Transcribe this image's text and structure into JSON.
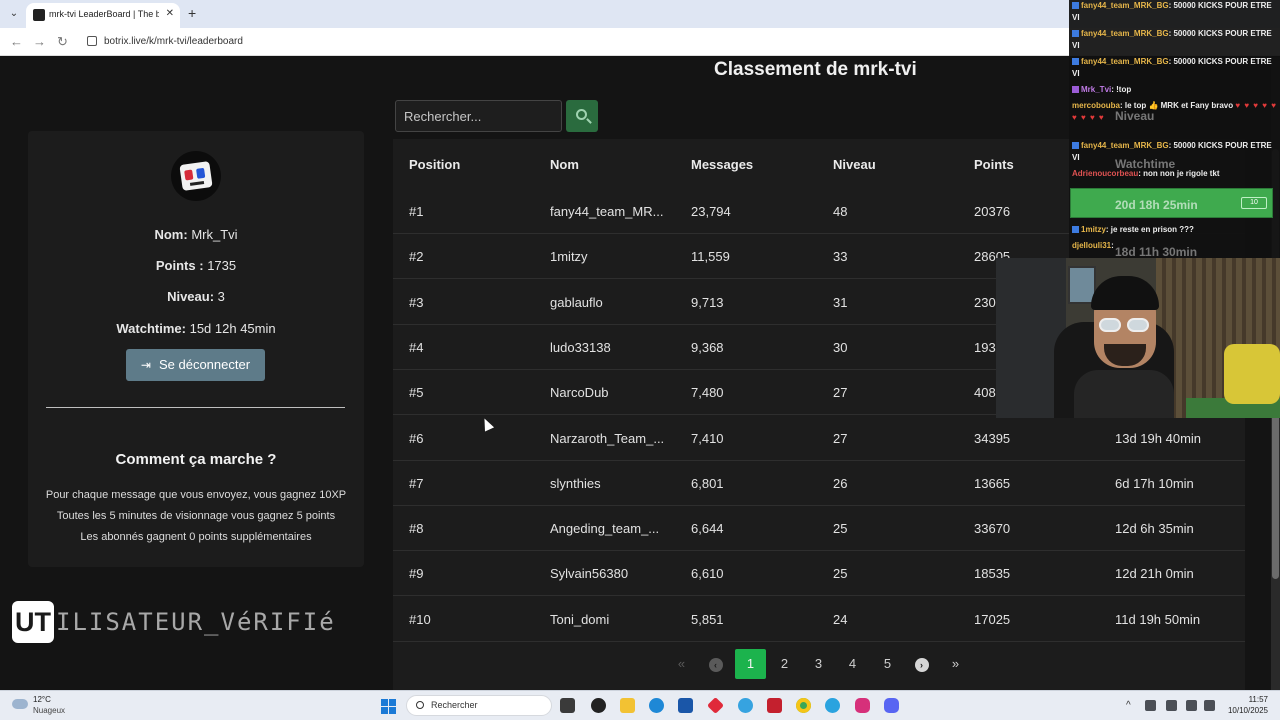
{
  "browser": {
    "tab_title": "mrk-tvi LeaderBoard | The best",
    "url": "botrix.live/k/mrk-tvi/leaderboard"
  },
  "profile": {
    "name_label": "Nom:",
    "name": "Mrk_Tvi",
    "points_label": "Points :",
    "points": "1735",
    "level_label": "Niveau:",
    "level": "3",
    "watchtime_label": "Watchtime:",
    "watchtime": "15d 12h 45min",
    "logout_label": "Se déconnecter"
  },
  "how": {
    "title": "Comment ça marche ?",
    "lines": [
      "Pour chaque message que vous envoyez, vous gagnez 10XP",
      "Toutes les 5 minutes de visionnage vous gagnez 5 points",
      "Les abonnés gagnent 0 points supplémentaires"
    ]
  },
  "overlay": {
    "verified_logo": "UT",
    "verified_text": "ILISATEUR_VéRIFIé"
  },
  "leaderboard": {
    "title": "Classement de mrk-tvi",
    "search_placeholder": "Rechercher...",
    "columns": [
      "Position",
      "Nom",
      "Messages",
      "Niveau",
      "Points"
    ],
    "rows": [
      {
        "position": "#1",
        "name": "fany44_team_MR...",
        "messages": "23,794",
        "level": "48",
        "points": "20376",
        "watchtime": ""
      },
      {
        "position": "#2",
        "name": "1mitzy",
        "messages": "11,559",
        "level": "33",
        "points": "28605",
        "watchtime": ""
      },
      {
        "position": "#3",
        "name": "gablauflo",
        "messages": "9,713",
        "level": "31",
        "points": "230",
        "watchtime": ""
      },
      {
        "position": "#4",
        "name": "ludo33138",
        "messages": "9,368",
        "level": "30",
        "points": "193",
        "watchtime": ""
      },
      {
        "position": "#5",
        "name": "NarcoDub",
        "messages": "7,480",
        "level": "27",
        "points": "408",
        "watchtime": ""
      },
      {
        "position": "#6",
        "name": "Narzaroth_Team_...",
        "messages": "7,410",
        "level": "27",
        "points": "34395",
        "watchtime": "13d 19h 40min"
      },
      {
        "position": "#7",
        "name": "slynthies",
        "messages": "6,801",
        "level": "26",
        "points": "13665",
        "watchtime": "6d 17h 10min"
      },
      {
        "position": "#8",
        "name": "Angeding_team_...",
        "messages": "6,644",
        "level": "25",
        "points": "33670",
        "watchtime": "12d 6h 35min"
      },
      {
        "position": "#9",
        "name": "Sylvain56380",
        "messages": "6,610",
        "level": "25",
        "points": "18535",
        "watchtime": "12d 21h 0min"
      },
      {
        "position": "#10",
        "name": "Toni_domi",
        "messages": "5,851",
        "level": "24",
        "points": "17025",
        "watchtime": "11d 19h 50min"
      }
    ],
    "pages": [
      "1",
      "2",
      "3",
      "4",
      "5"
    ],
    "current_page": "1"
  },
  "chat": {
    "messages": [
      {
        "user": "fany44_team_MRK_BG",
        "text": ": 50000 KICKS POUR ETRE VI"
      },
      {
        "user": "fany44_team_MRK_BG",
        "text": ": 50000 KICKS POUR ETRE VI"
      },
      {
        "user": "fany44_team_MRK_BG",
        "text": ": 50000 KICKS POUR ETRE VI"
      },
      {
        "user": "Mrk_Tvi",
        "text": ": !top"
      },
      {
        "user": "mercobouba",
        "text": ": le top 👍 MRK et Fany bravo"
      },
      {
        "user": "fany44_team_MRK_BG",
        "text": ": 50000 KICKS POUR ETRE VI"
      },
      {
        "user": "Adrienoucorbeau",
        "text": ": non non je rigole tkt"
      },
      {
        "user": "1mitzy",
        "text": ": je reste en prison ???"
      },
      {
        "user": "djellouli31",
        "text": ":"
      }
    ],
    "ghost_header_1": "Niveau",
    "ghost_header_2": "Watchtime",
    "ghost_wt_1": "20d 18h 25min",
    "ghost_wt_2": "18d 11h 30min",
    "alert_badge": "10"
  },
  "taskbar": {
    "temperature": "12°C",
    "weather": "Nuageux",
    "search": "Rechercher",
    "time": "11:57",
    "date": "10/10/2025"
  }
}
